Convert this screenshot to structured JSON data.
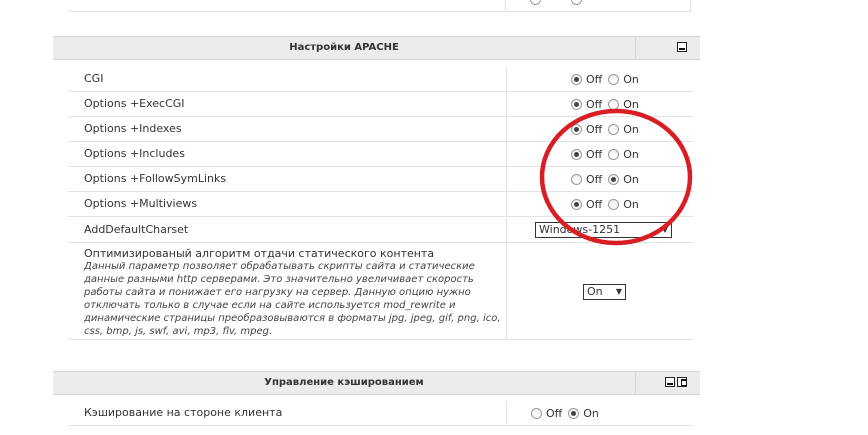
{
  "apache_panel": {
    "title": "Настройки APACHE",
    "rows": [
      {
        "label": "CGI",
        "options": [
          {
            "label": "Off",
            "checked": true
          },
          {
            "label": "On",
            "checked": false
          }
        ]
      },
      {
        "label": "Options +ExecCGI",
        "options": [
          {
            "label": "Off",
            "checked": true
          },
          {
            "label": "On",
            "checked": false
          }
        ]
      },
      {
        "label": "Options +Indexes",
        "options": [
          {
            "label": "Off",
            "checked": true
          },
          {
            "label": "On",
            "checked": false
          }
        ]
      },
      {
        "label": "Options +Includes",
        "options": [
          {
            "label": "Off",
            "checked": true
          },
          {
            "label": "On",
            "checked": false
          }
        ]
      },
      {
        "label": "Options +FollowSymLinks",
        "options": [
          {
            "label": "Off",
            "checked": false
          },
          {
            "label": "On",
            "checked": true
          }
        ]
      },
      {
        "label": "Options +Multiviews",
        "options": [
          {
            "label": "Off",
            "checked": true
          },
          {
            "label": "On",
            "checked": false
          }
        ]
      }
    ],
    "charset": {
      "label": "AddDefaultCharset",
      "value": "Windows-1251"
    },
    "static": {
      "title": "Оптимизированый алгоритм отдачи статического контента",
      "description": "Данный параметр позволяет обрабатывать скрипты сайта и статические данные разными http серверами. Это значительно увеличивает скорость работы сайта и понижает его нагрузку на сервер. Данную опцию нужно отключать только в случае если на сайте используется mod_rewrite и динамические страницы преобразовываются в форматы jpg, jpeg, gif, png, ico, css, bmp, js, swf, avi, mp3, flv, mpeg.",
      "value": "On"
    }
  },
  "cache_panel": {
    "title": "Управление кэшированием",
    "rows": [
      {
        "label": "Кэширование на стороне клиента",
        "options": [
          {
            "label": "Off",
            "checked": false
          },
          {
            "label": "On",
            "checked": true
          }
        ]
      }
    ]
  },
  "annotation": {
    "color": "#d81e25"
  }
}
